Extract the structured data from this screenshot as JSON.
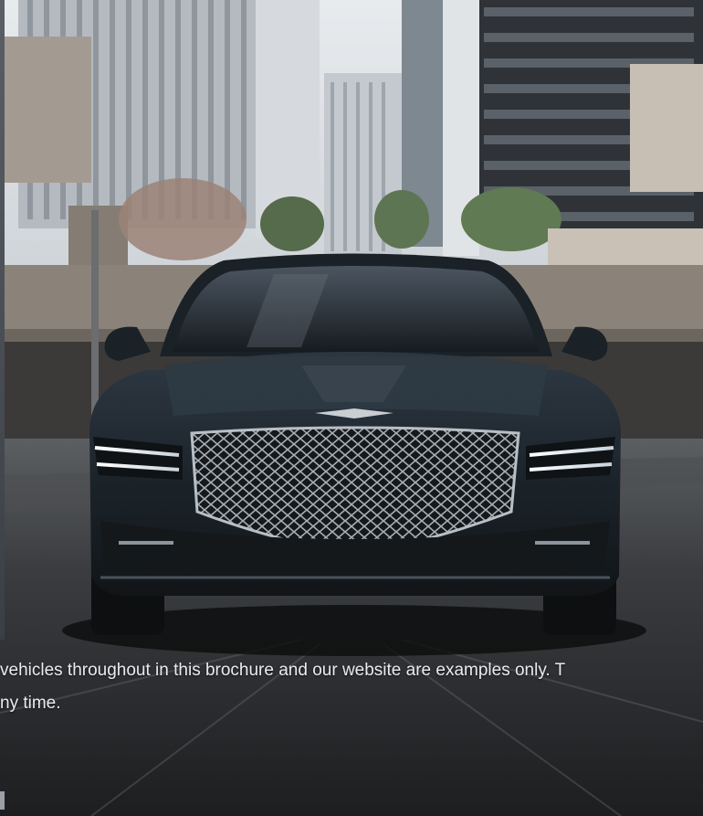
{
  "hero": {
    "alt": "Dark luxury sedan driving toward the viewer between city office buildings",
    "palette": {
      "sky": "#dfe3e6",
      "building_light": "#b9bfc4",
      "building_dark": "#3b3f44",
      "road": "#2b2d30",
      "car_body": "#1e262d",
      "grille": "#8d959c",
      "headlight": "#f4f7fa"
    }
  },
  "disclaimer": {
    "line1": "vehicles throughout in this brochure and our website are examples only. T",
    "line2": "ny time."
  }
}
